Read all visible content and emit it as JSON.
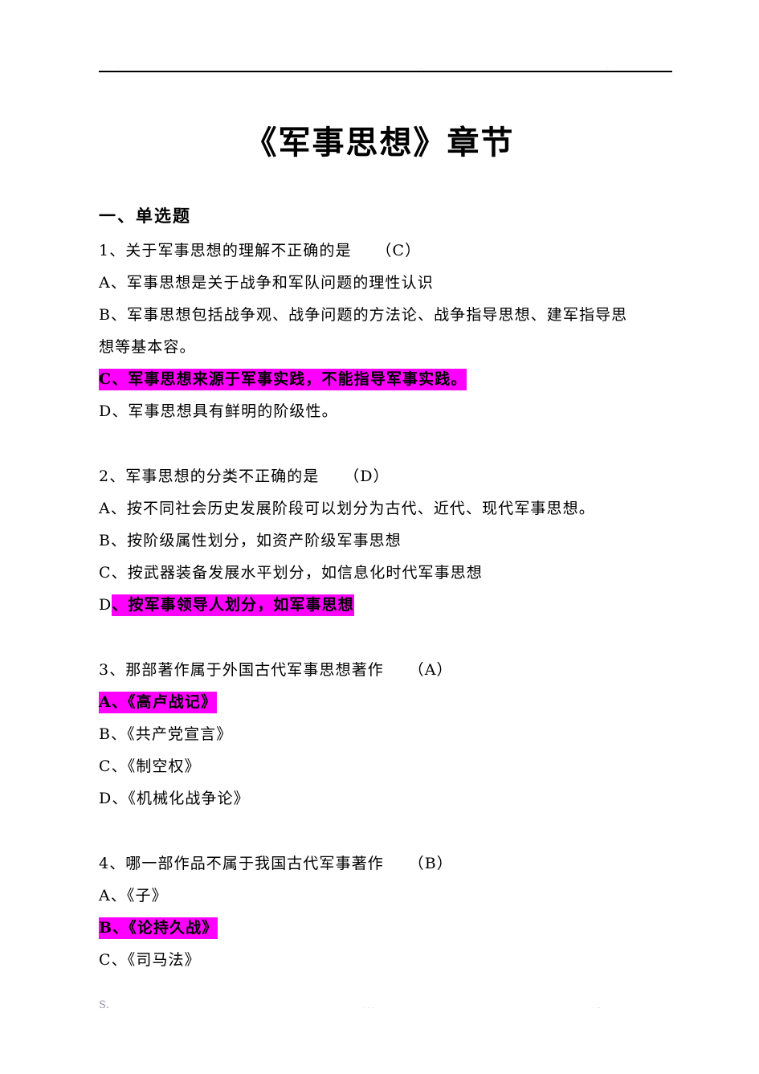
{
  "header": {
    "mark_left": "..",
    "mark_center": ". ..",
    "mark_right": ".  ."
  },
  "title": "《军事思想》章节",
  "section": {
    "heading": "一、单选题"
  },
  "questions": [
    {
      "stem": "1、关于军事思想的理解不正确的是　　（C）",
      "options": [
        {
          "lines": [
            "A、军事思想是关于战争和军队问题的理性认识"
          ],
          "highlighted": false,
          "plain_prefix": ""
        },
        {
          "lines": [
            "B、军事思想包括战争观、战争问题的方法论、战争指导思想、建军指导思",
            "想等基本容。"
          ],
          "highlighted": false,
          "plain_prefix": ""
        },
        {
          "lines": [
            "C、军事思想来源于军事实践，不能指导军事实践。"
          ],
          "highlighted": true,
          "plain_prefix": ""
        },
        {
          "lines": [
            "D、军事思想具有鲜明的阶级性。"
          ],
          "highlighted": false,
          "plain_prefix": ""
        }
      ]
    },
    {
      "stem": "2、军事思想的分类不正确的是　　（D）",
      "options": [
        {
          "lines": [
            "A、按不同社会历史发展阶段可以划分为古代、近代、现代军事思想。"
          ],
          "highlighted": false,
          "plain_prefix": ""
        },
        {
          "lines": [
            "B、按阶级属性划分，如资产阶级军事思想"
          ],
          "highlighted": false,
          "plain_prefix": ""
        },
        {
          "lines": [
            "C、按武器装备发展水平划分，如信息化时代军事思想"
          ],
          "highlighted": false,
          "plain_prefix": ""
        },
        {
          "lines": [
            "、按军事领导人划分，如军事思想"
          ],
          "highlighted": true,
          "plain_prefix": "D"
        }
      ]
    },
    {
      "stem": "3、那部著作属于外国古代军事思想著作　　（A）",
      "options": [
        {
          "lines": [
            "A、《高卢战记》"
          ],
          "highlighted": true,
          "plain_prefix": ""
        },
        {
          "lines": [
            "B、《共产党宣言》"
          ],
          "highlighted": false,
          "plain_prefix": ""
        },
        {
          "lines": [
            "C、《制空权》"
          ],
          "highlighted": false,
          "plain_prefix": ""
        },
        {
          "lines": [
            "D、《机械化战争论》"
          ],
          "highlighted": false,
          "plain_prefix": ""
        }
      ]
    },
    {
      "stem": "4、哪一部作品不属于我国古代军事著作　　（B）",
      "options": [
        {
          "lines": [
            "A、《子》"
          ],
          "highlighted": false,
          "plain_prefix": ""
        },
        {
          "lines": [
            "B、《论持久战》"
          ],
          "highlighted": true,
          "plain_prefix": ""
        },
        {
          "lines": [
            "C、《司马法》"
          ],
          "highlighted": false,
          "plain_prefix": ""
        }
      ]
    }
  ],
  "footer": {
    "mark_left": "S.",
    "mark_center": ". . .",
    "mark_right": ".  .."
  },
  "colors": {
    "highlight": "#ff00ff",
    "text": "#000000",
    "rule": "#000000"
  }
}
